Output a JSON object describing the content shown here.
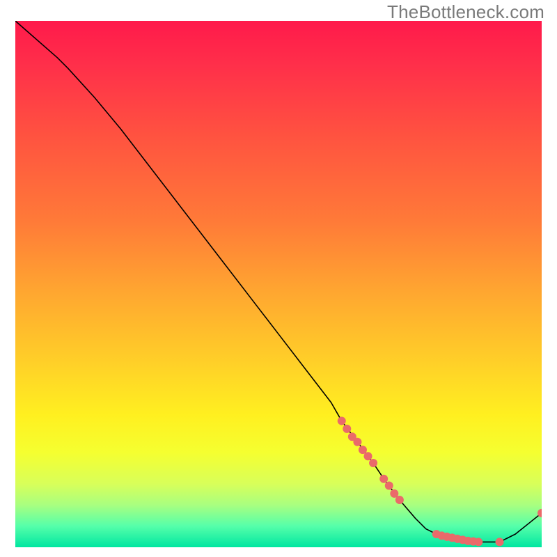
{
  "watermark": "TheBottleneck.com",
  "colors": {
    "curve": "#000000",
    "marker": "#ea6a6a",
    "gradient_top": "#ff1a4b",
    "gradient_bottom": "#00e6a0"
  },
  "chart_data": {
    "type": "line",
    "title": "",
    "xlabel": "",
    "ylabel": "",
    "xlim": [
      0,
      100
    ],
    "ylim": [
      0,
      100
    ],
    "grid": false,
    "series": [
      {
        "name": "bottleneck-curve",
        "x": [
          0,
          8,
          10,
          15,
          20,
          25,
          30,
          35,
          40,
          45,
          50,
          55,
          60,
          62,
          65,
          68,
          70,
          73,
          76,
          78,
          80,
          84,
          88,
          92,
          95,
          100
        ],
        "y": [
          100,
          93,
          91,
          85.5,
          79.5,
          73,
          66.5,
          60,
          53.5,
          47,
          40.5,
          34,
          27.5,
          24,
          20,
          16,
          13,
          9,
          5.5,
          3.5,
          2.5,
          1.5,
          1,
          1,
          2.5,
          6.5
        ]
      }
    ],
    "markers": {
      "name": "highlighted-points",
      "points": [
        {
          "x": 62,
          "y": 24
        },
        {
          "x": 63,
          "y": 22.5
        },
        {
          "x": 64,
          "y": 21
        },
        {
          "x": 65,
          "y": 20
        },
        {
          "x": 66,
          "y": 18.5
        },
        {
          "x": 67,
          "y": 17.3
        },
        {
          "x": 68,
          "y": 16
        },
        {
          "x": 70,
          "y": 13
        },
        {
          "x": 71,
          "y": 11.7
        },
        {
          "x": 72,
          "y": 10.2
        },
        {
          "x": 73,
          "y": 9
        },
        {
          "x": 80,
          "y": 2.5
        },
        {
          "x": 81,
          "y": 2.2
        },
        {
          "x": 82,
          "y": 2.0
        },
        {
          "x": 83,
          "y": 1.8
        },
        {
          "x": 84,
          "y": 1.6
        },
        {
          "x": 85,
          "y": 1.4
        },
        {
          "x": 86,
          "y": 1.2
        },
        {
          "x": 87,
          "y": 1.1
        },
        {
          "x": 88,
          "y": 1.0
        },
        {
          "x": 92,
          "y": 1.0
        },
        {
          "x": 100,
          "y": 6.5
        }
      ],
      "radius": 6
    }
  }
}
